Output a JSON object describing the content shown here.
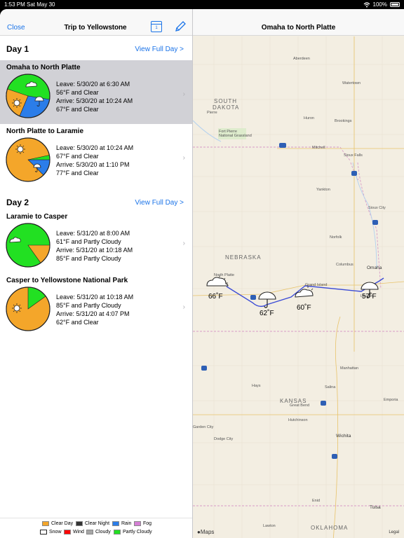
{
  "status": {
    "time": "1:53 PM",
    "date": "Sat May 30",
    "battery": "100%"
  },
  "nav": {
    "close": "Close",
    "title": "Trip to Yellowstone",
    "calendar_day": "1"
  },
  "days": [
    {
      "label": "Day 1",
      "link": "View Full Day >"
    },
    {
      "label": "Day 2",
      "link": "View Full Day >"
    }
  ],
  "legs": [
    {
      "title": "Omaha to North Platte",
      "leave": "Leave: 5/30/20 at 6:30 AM",
      "leave_weather": "56°F and Clear",
      "arrive": "Arrive: 5/30/20 at 10:24 AM",
      "arrive_weather": "67°F and Clear",
      "selected": true
    },
    {
      "title": "North Platte to Laramie",
      "leave": "Leave: 5/30/20 at 10:24 AM",
      "leave_weather": "67°F and Clear",
      "arrive": "Arrive: 5/30/20 at 1:10 PM",
      "arrive_weather": "77°F and Clear"
    },
    {
      "title": "Laramie to Casper",
      "leave": "Leave: 5/31/20 at 8:00 AM",
      "leave_weather": "61°F and Partly Cloudy",
      "arrive": "Arrive: 5/31/20 at 10:18 AM",
      "arrive_weather": "85°F and Partly Cloudy"
    },
    {
      "title": "Casper to Yellowstone National Park",
      "leave": "Leave: 5/31/20 at 10:18 AM",
      "leave_weather": "85°F and Partly Cloudy",
      "arrive": "Arrive: 5/31/20 at 4:07 PM",
      "arrive_weather": "62°F and Clear"
    }
  ],
  "legend": [
    {
      "label": "Clear Day",
      "color": "#f4a62a"
    },
    {
      "label": "Clear Night",
      "color": "#333333"
    },
    {
      "label": "Rain",
      "color": "#2b7de9"
    },
    {
      "label": "Fog",
      "color": "#d47fd4"
    },
    {
      "label": "Snow",
      "color": "#ffffff"
    },
    {
      "label": "Wind",
      "color": "#ff0000"
    },
    {
      "label": "Cloudy",
      "color": "#a6a6a6"
    },
    {
      "label": "Partly Cloudy",
      "color": "#22e022"
    }
  ],
  "map": {
    "title": "Omaha to North Platte",
    "attribution": "Maps",
    "legal": "Legal",
    "states": [
      "SOUTH",
      "DAKOTA",
      "NEBRASKA",
      "KANSAS",
      "OKLAHOMA"
    ],
    "park": [
      "Fort Pierre",
      "National Grassland"
    ],
    "cities": [
      "Aberdeen",
      "Watertown",
      "Pierre",
      "Huron",
      "Brookings",
      "Mitchell",
      "Sioux Falls",
      "Yankton",
      "Sioux City",
      "Norfolk",
      "Columbus",
      "Omaha",
      "Lincoln",
      "Grand Island",
      "North Platte",
      "Manhattan",
      "Salina",
      "Hays",
      "Great Bend",
      "Hutchinson",
      "Wichita",
      "Dodge City",
      "Garden City",
      "Emporia",
      "Tulsa",
      "Enid",
      "Lawton"
    ],
    "temps": [
      "66˚F",
      "62˚F",
      "60˚F",
      "57˚F"
    ],
    "route_color": "#3b4bd6"
  }
}
